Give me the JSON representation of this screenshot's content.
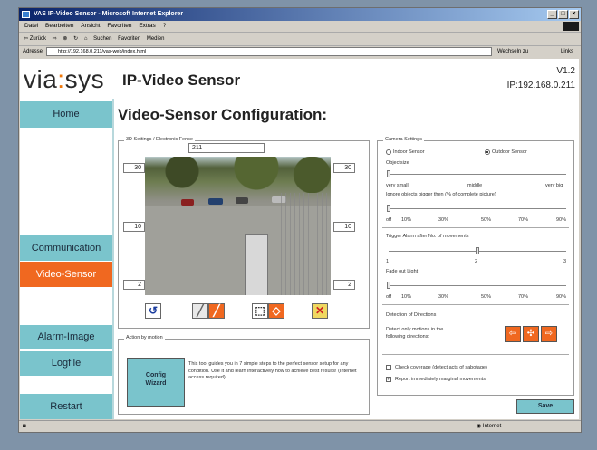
{
  "browser": {
    "title": "VAS IP-Video Sensor - Microsoft Internet Explorer",
    "menus": [
      "Datei",
      "Bearbeiten",
      "Ansicht",
      "Favoriten",
      "Extras",
      "?"
    ],
    "toolbar": {
      "back": "⇦ Zurück",
      "search": "Suchen",
      "favorites": "Favoriten",
      "media": "Medien"
    },
    "address_label": "Adresse",
    "url": "http://192.168.0.211/vas-web/index.html",
    "go_label": "Wechseln zu",
    "links_label": "Links",
    "status_zone": "Internet"
  },
  "header": {
    "logo_left": "via",
    "logo_colon": ":",
    "logo_right": "sys",
    "title": "IP-Video Sensor",
    "version": "V1.2",
    "ip": "IP:192.168.0.211"
  },
  "nav": {
    "home": "Home",
    "communication": "Communication",
    "video_sensor": "Video-Sensor",
    "alarm_image": "Alarm-Image",
    "logfile": "Logfile",
    "restart": "Restart"
  },
  "page_title": "Video-Sensor Configuration:",
  "fence": {
    "legend": "3D Settings / Electronic Fence",
    "top": "211",
    "left_top": "30",
    "right_top": "30",
    "left_mid": "10",
    "right_mid": "10",
    "left_bottom": "2",
    "right_bottom": "2"
  },
  "action": {
    "legend": "Action by motion",
    "wizard_line1": "Config",
    "wizard_line2": "Wizard",
    "description": "This tool guides you in 7 simple steps to the perfect sensor setup for any condition. Use it and learn interactively how to achieve best results! (Internet access required)"
  },
  "camera": {
    "legend": "Camera Settings",
    "indoor": "Indoor Sensor",
    "outdoor": "Outdoor Sensor",
    "objectsize": "Objectsize",
    "size_labels": [
      "very small",
      "middle",
      "very big"
    ],
    "ignore_label": "Ignore objects bigger then (% of complete picture)",
    "pct_labels": [
      "off",
      "10%",
      "30%",
      "50%",
      "70%",
      "90%"
    ],
    "trigger_label": "Trigger Alarm after No. of movements",
    "trigger_ticks": [
      "1",
      "2",
      "3"
    ],
    "fade_label": "Fade out Light",
    "fade_ticks": [
      "off",
      "10%",
      "30%",
      "50%",
      "70%",
      "90%"
    ],
    "detection_label": "Detection of Directions",
    "detect_line1": "Detect only motions in the",
    "detect_line2": "following directions:",
    "check_coverage": "Check coverage (detect acts of sabotage)",
    "report_marginal": "Report immediately marginal movements",
    "save": "Save"
  },
  "values": {
    "objectsize_level": 0.0,
    "ignore_level": 0.0,
    "trigger_level": 0.5,
    "fade_level": 0.0
  }
}
